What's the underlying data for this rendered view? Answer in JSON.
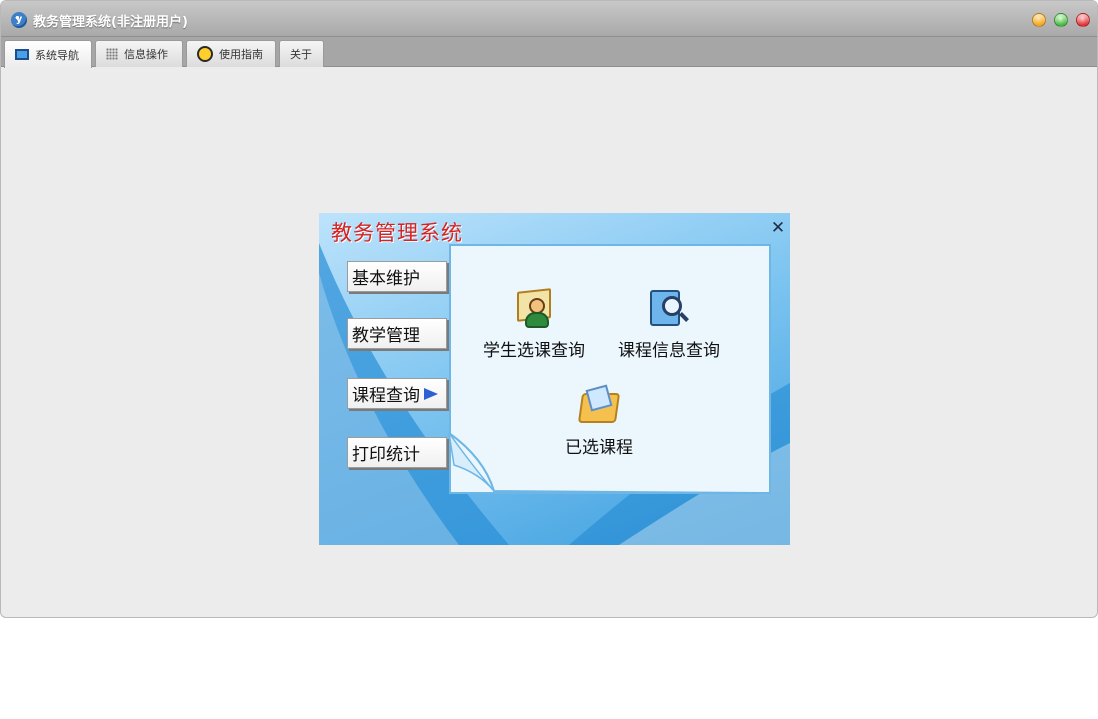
{
  "window": {
    "title": "教务管理系统(非注册用户)",
    "logo_icon": "app-logo-icon"
  },
  "tabs": [
    {
      "label": "系统导航",
      "icon": "monitor-icon",
      "active": true
    },
    {
      "label": "信息操作",
      "icon": "grid-icon",
      "active": false
    },
    {
      "label": "使用指南",
      "icon": "clock-icon",
      "active": false
    },
    {
      "label": "关于",
      "active": false
    }
  ],
  "dialog": {
    "title": "教务管理系统",
    "close_label": "✕",
    "menu": [
      {
        "label": "基本维护"
      },
      {
        "label": "教学管理"
      },
      {
        "label": "课程查询",
        "selected": true
      },
      {
        "label": "打印统计"
      }
    ],
    "features": [
      {
        "label": "学生选课查询",
        "icon": "book-person-icon"
      },
      {
        "label": "课程信息查询",
        "icon": "magnifier-icon"
      },
      {
        "label": "已选课程",
        "icon": "folder-icon"
      }
    ]
  },
  "colors": {
    "accent_red": "#d8221f",
    "tab_bar": "#a6a6a6",
    "dialog_blue": "#3e9fdf"
  }
}
